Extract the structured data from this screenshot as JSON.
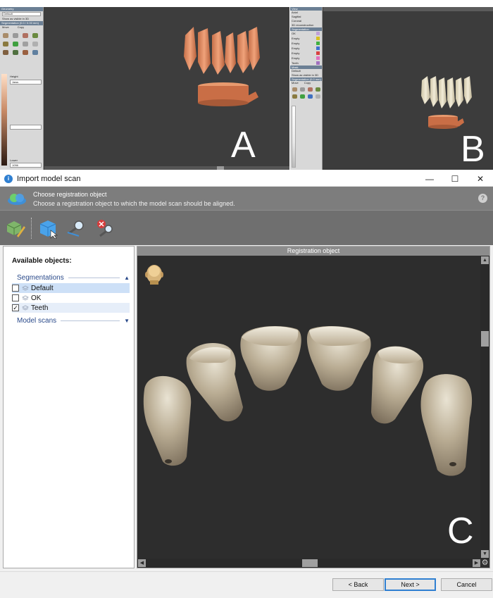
{
  "panel_a": {
    "letter": "A",
    "sidebar": {
      "header1": "Geometry",
      "dropdown": "Default",
      "checkbox_label": "Show as visible in 3D",
      "header2": "Segmentation (0.0 / 0.00 mm)",
      "mode_move": "Move",
      "mode_copy": "Copy",
      "height_label": "Height",
      "height_value": "Jaws",
      "lower_label": "Lower",
      "lower_value": "1056"
    }
  },
  "panel_b": {
    "letter": "B",
    "sidebar": {
      "header_view": "View",
      "view_options": [
        "Axial",
        "Sagittal",
        "Coronal",
        "3D reconstruction"
      ],
      "header_seg": "Segmentation",
      "segments": [
        "OK",
        "Empty",
        "Empty",
        "Empty",
        "Empty",
        "Empty",
        "Teeth"
      ],
      "segment_colors": [
        "#c0a0d8",
        "#d8c020",
        "#40b040",
        "#4070d0",
        "#d84040",
        "#e070c0",
        "#a070c0"
      ],
      "header_mask": "Mask",
      "mask_value": "Default",
      "checkbox_label": "Show as visible in 3D",
      "header_seg2": "Segmentation (0.0 mm)",
      "mode_move": "Move",
      "mode_copy": "Copy"
    }
  },
  "dialog": {
    "letter": "C",
    "title": "Import model scan",
    "win_min": "—",
    "win_max": "☐",
    "win_close": "✕",
    "banner_heading": "Choose registration object",
    "banner_sub": "Choose a registration object to which the model scan should be aligned.",
    "help": "?",
    "available_title": "Available objects:",
    "groups": [
      {
        "label": "Segmentations",
        "chevron": "▲"
      },
      {
        "label": "Model scans",
        "chevron": "▼"
      }
    ],
    "items": [
      {
        "label": "Default",
        "checked": false,
        "mark": ""
      },
      {
        "label": "OK",
        "checked": false,
        "mark": ""
      },
      {
        "label": "Teeth",
        "checked": true,
        "mark": "✓"
      }
    ],
    "registration_title": "Registration object",
    "buttons": {
      "back": "< Back",
      "next": "Next >",
      "cancel": "Cancel"
    }
  }
}
